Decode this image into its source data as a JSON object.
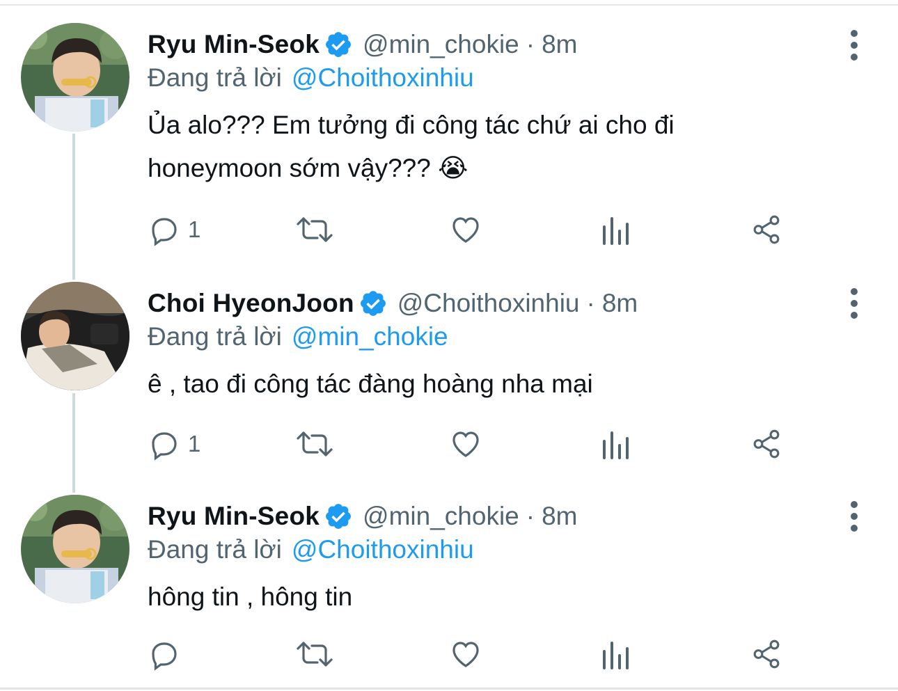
{
  "colors": {
    "accent": "#1d9bf0",
    "secondary_text": "#536471",
    "primary_text": "#0f1419",
    "thread_line": "#cfd9de"
  },
  "icons": {
    "reply": "speech-bubble-icon",
    "retweet": "retweet-arrows-icon",
    "like": "heart-icon",
    "views": "bar-chart-icon",
    "share": "share-nodes-icon",
    "verified": "verified-badge-icon",
    "more": "three-dots-vertical-icon"
  },
  "tweets": [
    {
      "name": "Ryu Min-Seok",
      "handle": "@min_chokie",
      "separator": "·",
      "time": "8m",
      "reply_prefix": "Đang trả lời",
      "reply_to": "@Choithoxinhiu",
      "text_lines": [
        "Ủa alo??? Em tưởng đi công tác chứ ai cho đi",
        "honeymoon sớm vậy??? 😭"
      ],
      "reply_count": "1"
    },
    {
      "name": "Choi HyeonJoon",
      "handle": "@Choithoxinhiu",
      "separator": "·",
      "time": "8m",
      "reply_prefix": "Đang trả lời",
      "reply_to": "@min_chokie",
      "text_lines": [
        "ê , tao đi công tác đàng hoàng nha mại"
      ],
      "reply_count": "1"
    },
    {
      "name": "Ryu Min-Seok",
      "handle": "@min_chokie",
      "separator": "·",
      "time": "8m",
      "reply_prefix": "Đang trả lời",
      "reply_to": "@Choithoxinhiu",
      "text_lines": [
        "hông tin , hông tin"
      ],
      "reply_count": ""
    }
  ]
}
